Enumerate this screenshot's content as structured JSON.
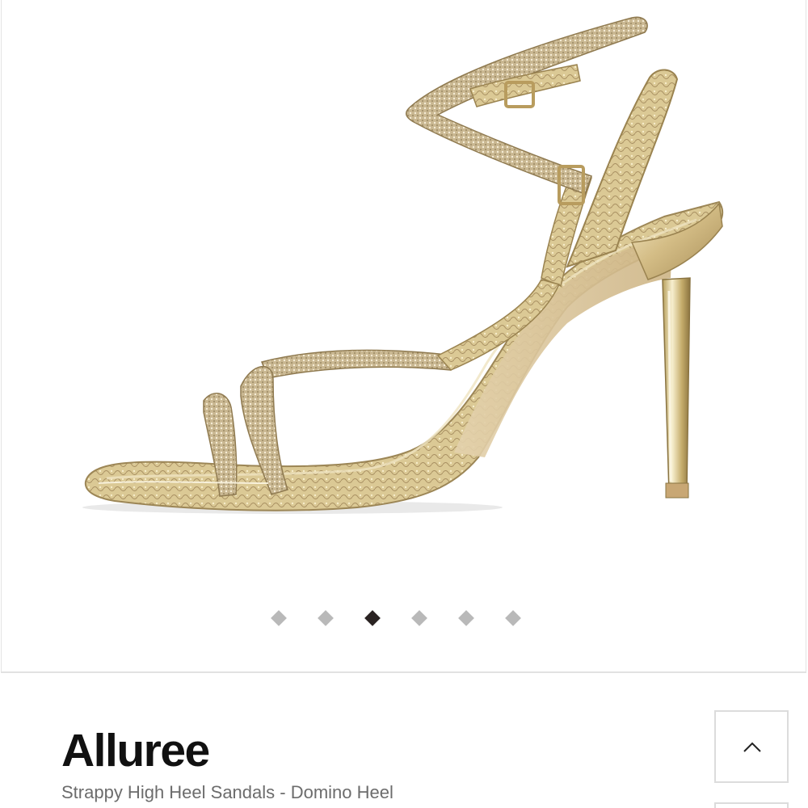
{
  "product": {
    "brand": "Alluree",
    "subtitle": "Strappy High Heel Sandals - Domino Heel"
  },
  "gallery": {
    "image_icon": "gold-strappy-sandal-image",
    "slide_count": 6,
    "active_slide": 3,
    "dot_color": "#b9b9b9",
    "active_dot_color": "#2a2322"
  },
  "controls": {
    "scroll_top_icon": "chevron-up-icon"
  }
}
